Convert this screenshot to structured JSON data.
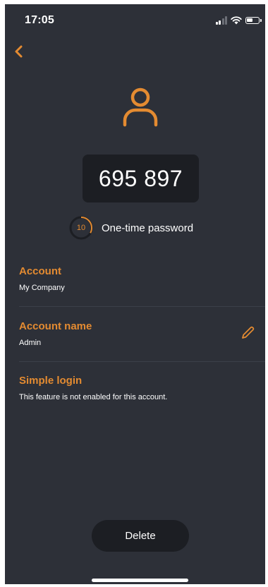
{
  "status_bar": {
    "time": "17:05",
    "icons": [
      "signal-icon",
      "wifi-icon",
      "battery-icon"
    ]
  },
  "header": {
    "back_icon": "chevron-left-icon"
  },
  "profile": {
    "icon": "user-icon"
  },
  "otp": {
    "code": "695 897",
    "timer_seconds": "10",
    "timer_remaining_fraction": 0.33,
    "label": "One-time password"
  },
  "sections": {
    "account": {
      "title": "Account",
      "value": "My Company"
    },
    "account_name": {
      "title": "Account name",
      "value": "Admin",
      "edit_icon": "pencil-icon"
    },
    "simple_login": {
      "title": "Simple login",
      "value": "This feature is not enabled for this account."
    }
  },
  "actions": {
    "delete_label": "Delete"
  },
  "colors": {
    "background": "#2d3038",
    "accent": "#e48b31",
    "surface": "#1c1e23",
    "text": "#ffffff"
  }
}
